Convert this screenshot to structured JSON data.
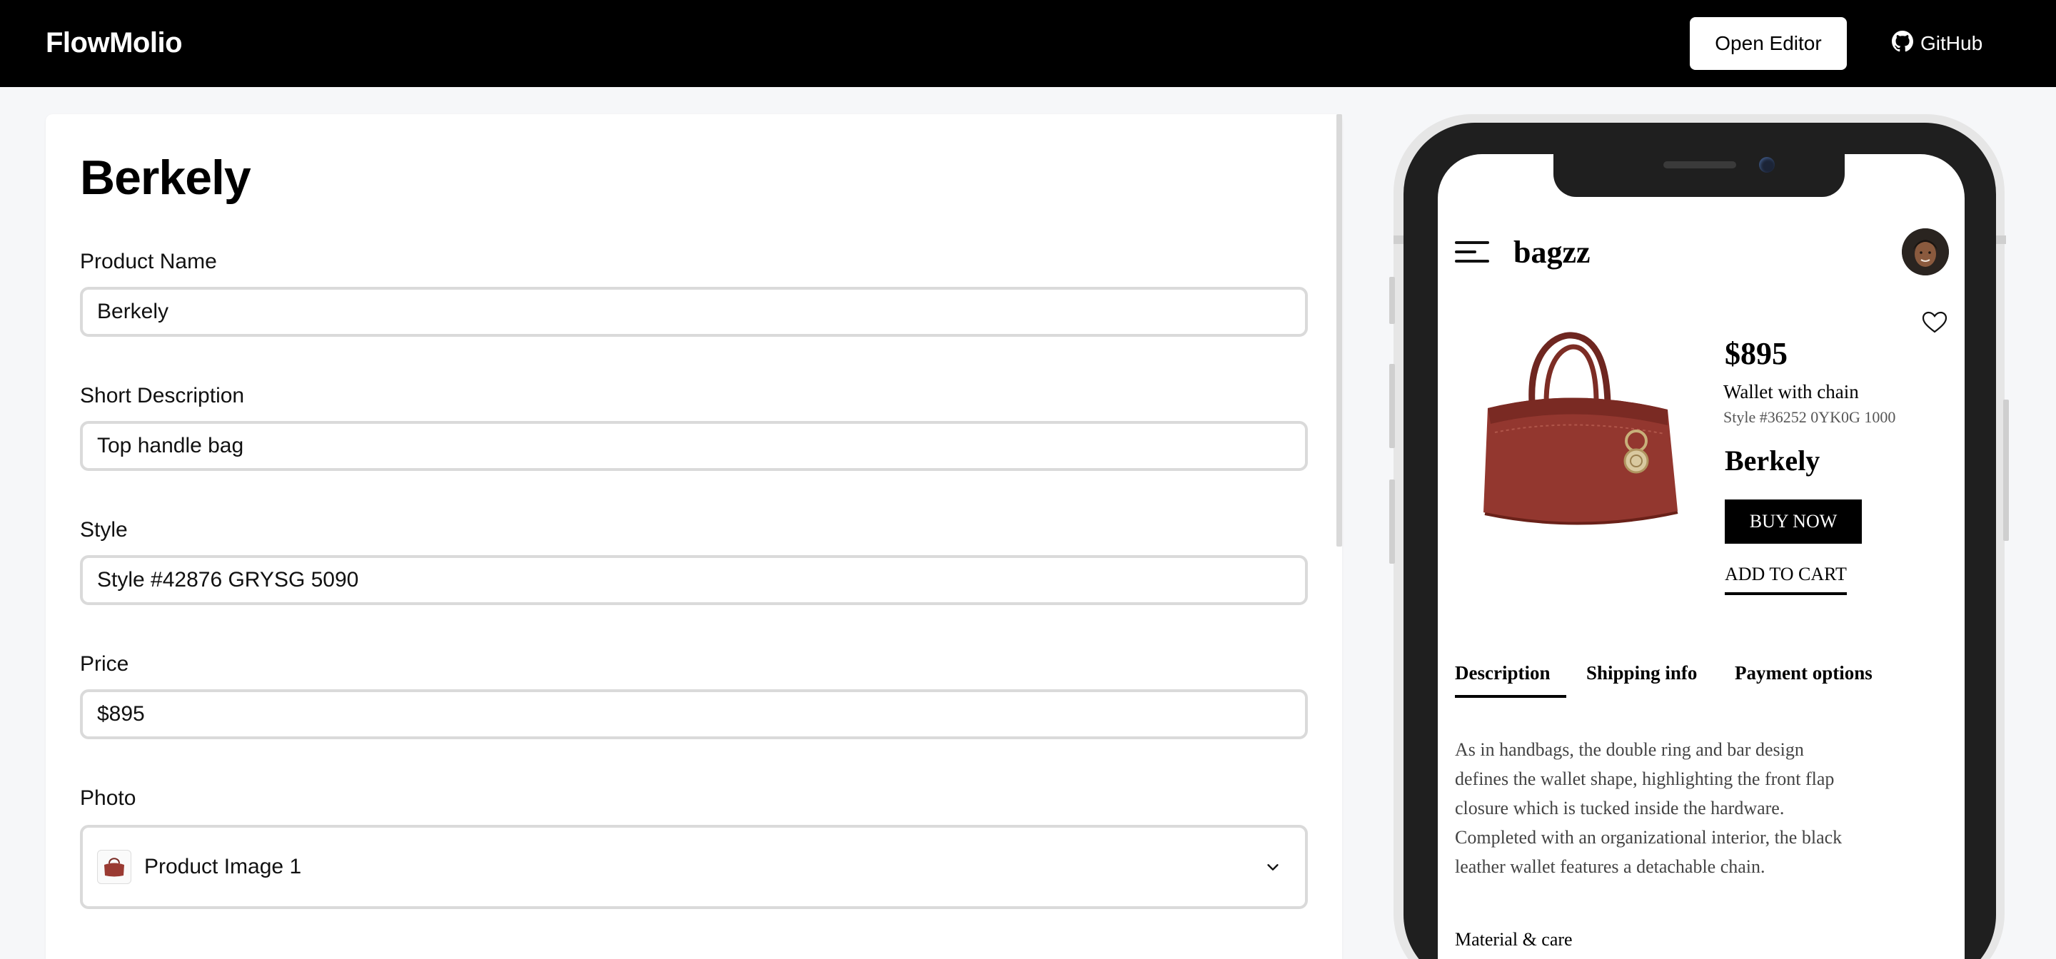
{
  "app": {
    "brand": "FlowMolio",
    "open_editor_label": "Open Editor",
    "github_label": "GitHub"
  },
  "editor": {
    "title": "Berkely",
    "fields": {
      "product_name": {
        "label": "Product Name",
        "value": "Berkely"
      },
      "short_description": {
        "label": "Short Description",
        "value": "Top handle bag"
      },
      "style": {
        "label": "Style",
        "value": "Style #42876 GRYSG 5090"
      },
      "price": {
        "label": "Price",
        "value": "$895"
      },
      "photo": {
        "label": "Photo",
        "value": "Product Image 1"
      }
    }
  },
  "preview": {
    "brand": "bagzz",
    "price": "$895",
    "subtitle": "Wallet with chain",
    "style": "Style #36252 0YK0G 1000",
    "name": "Berkely",
    "buy_now": "BUY NOW",
    "add_to_cart": "ADD TO CART",
    "tabs": [
      "Description",
      "Shipping info",
      "Payment options"
    ],
    "active_tab": "Description",
    "description": "As in handbags, the double ring and bar design defines the wallet shape, highlighting the front flap closure which is tucked inside the hardware. Completed with an organizational interior, the black leather wallet features a detachable chain.",
    "material_heading": "Material & care"
  },
  "icons": {
    "github": "github-icon",
    "chevron": "chevron-down-icon",
    "menu": "menu-icon",
    "heart": "heart-icon",
    "avatar": "avatar"
  },
  "colors": {
    "topbar": "#000000",
    "accent": "#000000",
    "bag": "#8e342c"
  }
}
